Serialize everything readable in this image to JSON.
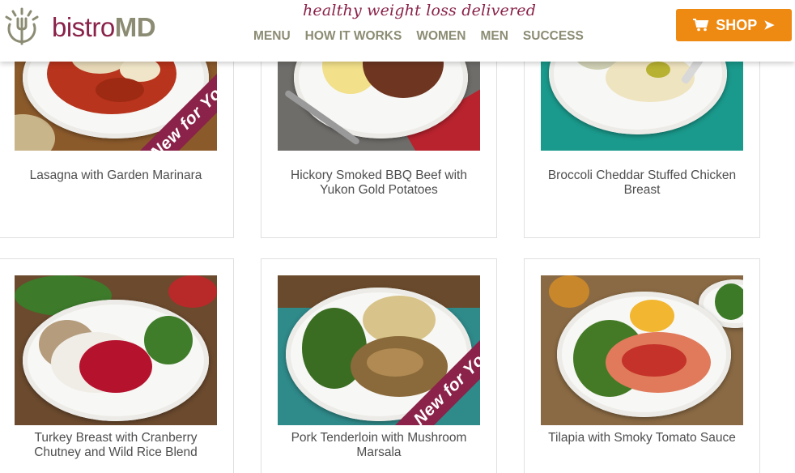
{
  "header": {
    "brand_bistro": "bistro",
    "brand_md": "MD",
    "tagline": "healthy weight loss delivered",
    "nav": [
      "MENU",
      "HOW IT WORKS",
      "WOMEN",
      "MEN",
      "SUCCESS"
    ],
    "shop_label": "SHOP",
    "shop_arrow": "➤"
  },
  "badge": {
    "text": "New for You",
    "color": "#8a2249"
  },
  "colors": {
    "brand": "#8a2249",
    "accent": "#ee8a12",
    "nav": "#8c8c74"
  },
  "meals": [
    {
      "name": "Lasagna with Garden Marinara",
      "is_new": true
    },
    {
      "name": "Hickory Smoked BBQ Beef with Yukon Gold Potatoes",
      "is_new": false
    },
    {
      "name": "Broccoli Cheddar Stuffed Chicken Breast",
      "is_new": false
    },
    {
      "name": "Turkey Breast with Cranberry Chutney and Wild Rice Blend",
      "is_new": false
    },
    {
      "name": "Pork Tenderloin with Mushroom Marsala",
      "is_new": true
    },
    {
      "name": "Tilapia with Smoky Tomato Sauce",
      "is_new": false
    }
  ]
}
